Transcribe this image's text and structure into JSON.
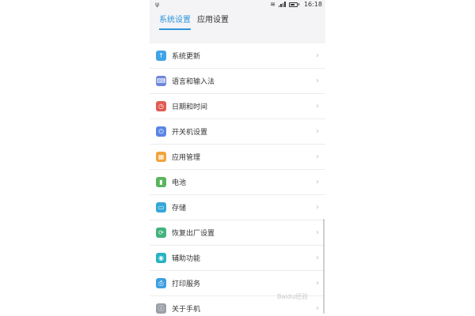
{
  "status": {
    "time": "16:18",
    "usb": "ψ",
    "wifi": "≋"
  },
  "tabs": [
    {
      "label": "系统设置",
      "active": true
    },
    {
      "label": "应用设置",
      "active": false
    }
  ],
  "items": [
    {
      "label": "系统更新",
      "icon": "system-update-icon",
      "color": "#3fa3e6",
      "glyph": "↑"
    },
    {
      "label": "语言和输入法",
      "icon": "keyboard-icon",
      "color": "#6c86dd",
      "glyph": "⌨"
    },
    {
      "label": "日期和时间",
      "icon": "clock-icon",
      "color": "#e25a52",
      "glyph": "◷"
    },
    {
      "label": "开关机设置",
      "icon": "power-icon",
      "color": "#5b86e5",
      "glyph": "⏻"
    },
    {
      "label": "应用管理",
      "icon": "apps-icon",
      "color": "#f1a43a",
      "glyph": "▦"
    },
    {
      "label": "电池",
      "icon": "battery-icon",
      "color": "#59b55c",
      "glyph": "▮"
    },
    {
      "label": "存储",
      "icon": "storage-icon",
      "color": "#35a8d9",
      "glyph": "▭"
    },
    {
      "label": "恢复出厂设置",
      "icon": "reset-icon",
      "color": "#43b37e",
      "glyph": "⟳"
    },
    {
      "label": "辅助功能",
      "icon": "accessibility-icon",
      "color": "#27b3c4",
      "glyph": "◉"
    },
    {
      "label": "打印服务",
      "icon": "print-icon",
      "color": "#3e9fe0",
      "glyph": "⎙"
    },
    {
      "label": "关于手机",
      "icon": "info-icon",
      "color": "#9aa0a7",
      "glyph": "ⓘ"
    }
  ],
  "chevron": "›",
  "watermark": "Baidu经验"
}
